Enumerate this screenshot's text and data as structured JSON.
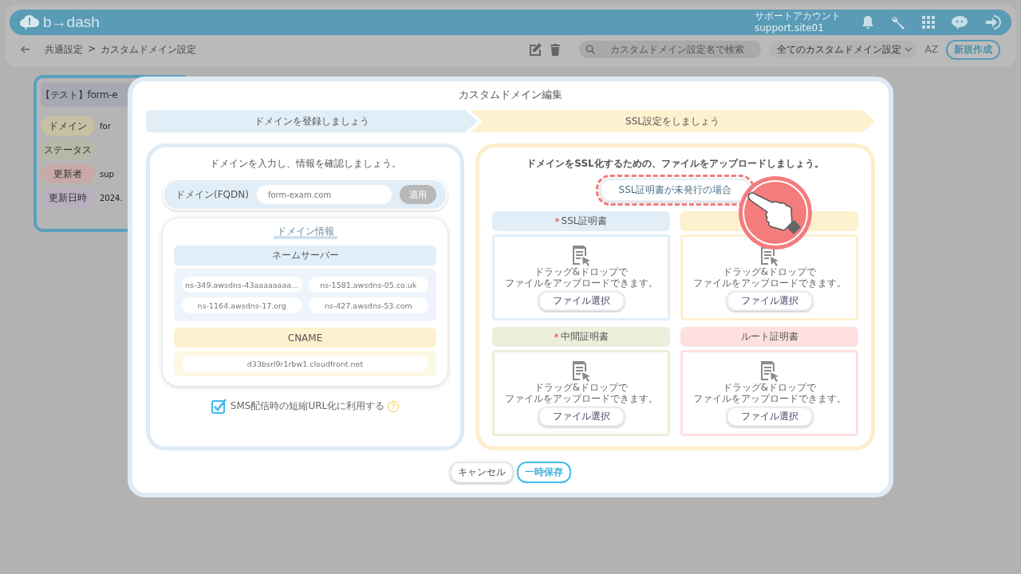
{
  "header": {
    "logo": "b→dash",
    "account_name": "サポートアカウント",
    "account_id": "support.site01"
  },
  "toolbar": {
    "breadcrumb": [
      {
        "label": "共通設定"
      },
      {
        "label": ">"
      },
      {
        "label": "カスタムドメイン設定"
      }
    ],
    "search": {
      "placeholder": "カスタムドメイン設定名で検索"
    },
    "filter": {
      "value": "全てのカスタムドメイン設定"
    },
    "sort_label": "AZ",
    "new_button": "新規作成"
  },
  "background_card": {
    "title": "【テスト】form-e",
    "rows": [
      {
        "label": "ドメイン",
        "value": "for",
        "color": "#c8c0a3"
      },
      {
        "label": "ステータス",
        "color": "#b6b9a6"
      },
      {
        "label": "更新者",
        "value": "sup",
        "color": "#c8a9a7"
      },
      {
        "label": "更新日時",
        "value": "2024.",
        "color": "#b9aec0"
      }
    ]
  },
  "modal": {
    "title": "カスタムドメイン編集",
    "steps": [
      {
        "label": "ドメインを登録しましょう",
        "color": "#e1eef8"
      },
      {
        "label": "SSL設定をしましょう",
        "color": "#fdf1cf"
      }
    ],
    "domain_panel": {
      "intro": "ドメインを入力し、情報を確認しましょう。",
      "field_label": "ドメイン(FQDN)",
      "field_value": "form-exam.com",
      "apply_button": "適用",
      "apply_disabled": true,
      "info_title": "ドメイン情報",
      "nameserver_header": "ネームサーバー",
      "nameservers": [
        "ns-349.awsdns-43aaaaaaaa…",
        "ns-1581.awsdns-05.co.uk",
        "ns-1164.awsdns-17.org",
        "ns-427.awsdns-53.com"
      ],
      "cname_header": "CNAME",
      "cname": "d33bsrl9r1rbw1.cloudfront.net",
      "sms_checkbox": {
        "label": "SMS配信時の短縮URL化に利用する",
        "checked": true,
        "help": "?"
      }
    },
    "ssl_panel": {
      "intro": "ドメインをSSL化するための、ファイルをアップロードしましょう。",
      "unissued_button": "SSL証明書が未発行の場合",
      "certificates": [
        {
          "label": "SSL証明書",
          "required_mark": "*",
          "color": "#e1eef8",
          "drop_lines": [
            "ドラッグ&ドロップで",
            "ファイルをアップロードできます。"
          ],
          "button": "ファイル選択"
        },
        {
          "color": "#fdf1cf",
          "drop_lines": [
            "ドラッグ&ドロップで",
            "ファイルをアップロードできます。"
          ],
          "button": "ファイル選択"
        },
        {
          "label": "中間証明書",
          "required_mark": "*",
          "color": "#ecefd9",
          "drop_lines": [
            "ドラッグ&ドロップで",
            "ファイルをアップロードできます。"
          ],
          "button": "ファイル選択"
        },
        {
          "label": "ルート証明書",
          "color": "#fde0df",
          "drop_lines": [
            "ドラッグ&ドロップで",
            "ファイルをアップロードできます。"
          ],
          "button": "ファイル選択"
        }
      ]
    },
    "buttons": [
      {
        "label": "キャンセル",
        "kind": "secondary"
      },
      {
        "label": "一時保存",
        "kind": "primary"
      }
    ]
  }
}
